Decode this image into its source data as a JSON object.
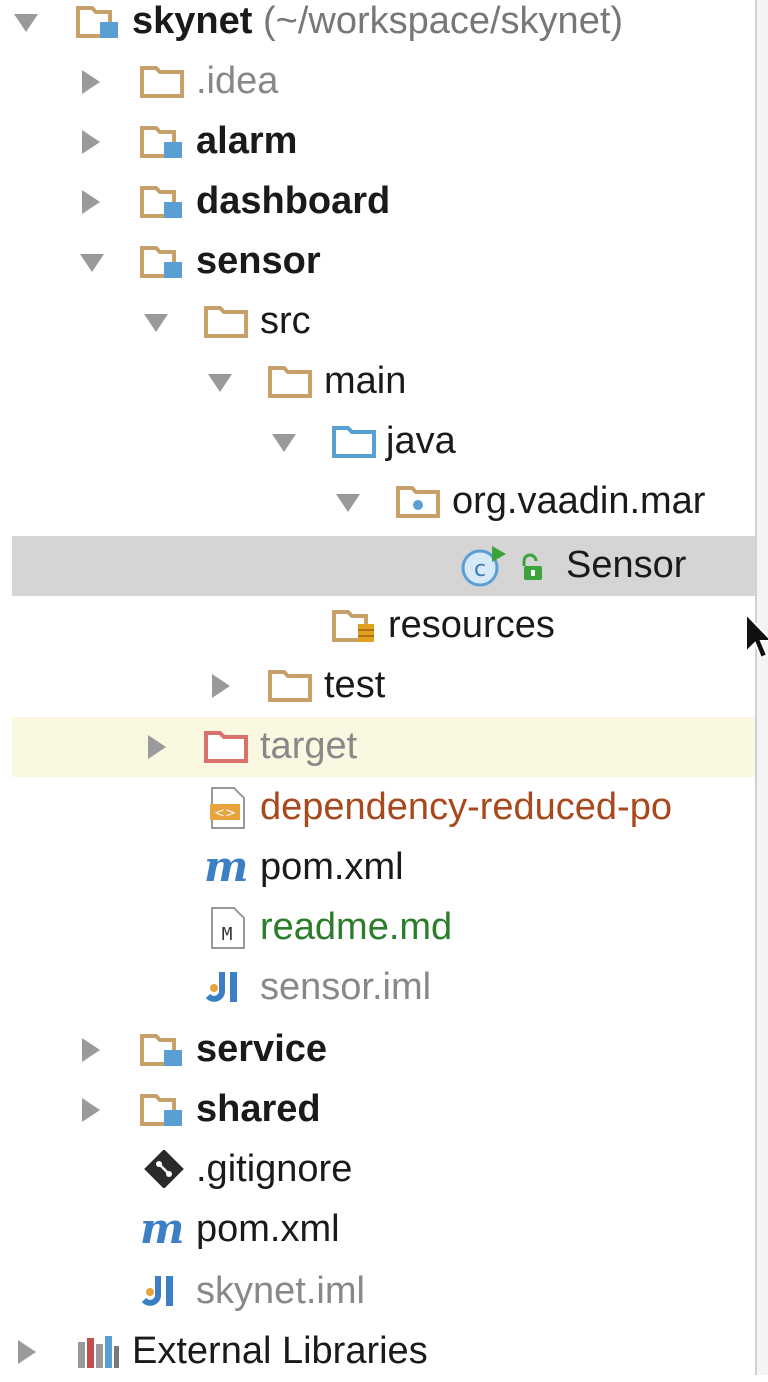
{
  "tree": {
    "root": {
      "name": "skynet",
      "path": "(~/workspace/skynet)"
    },
    "idea": ".idea",
    "alarm": "alarm",
    "dashboard": "dashboard",
    "sensor": "sensor",
    "src": "src",
    "main": "main",
    "java": "java",
    "package": "org.vaadin.mar",
    "sensor_class": "Sensor",
    "resources": "resources",
    "test": "test",
    "target": "target",
    "dependency_pom": "dependency-reduced-po",
    "sensor_pom": "pom.xml",
    "readme": "readme.md",
    "sensor_iml": "sensor.iml",
    "service": "service",
    "shared": "shared",
    "gitignore": ".gitignore",
    "root_pom": "pom.xml",
    "skynet_iml": "skynet.iml",
    "external_libraries": "External Libraries"
  },
  "colors": {
    "folder": "#c8a06a",
    "module_badge": "#5a9fd4",
    "source_folder": "#5a9fd4",
    "excluded_folder": "#d9726a",
    "selection": "#d5d5d5",
    "ignored_row": "#fbf8e1"
  }
}
